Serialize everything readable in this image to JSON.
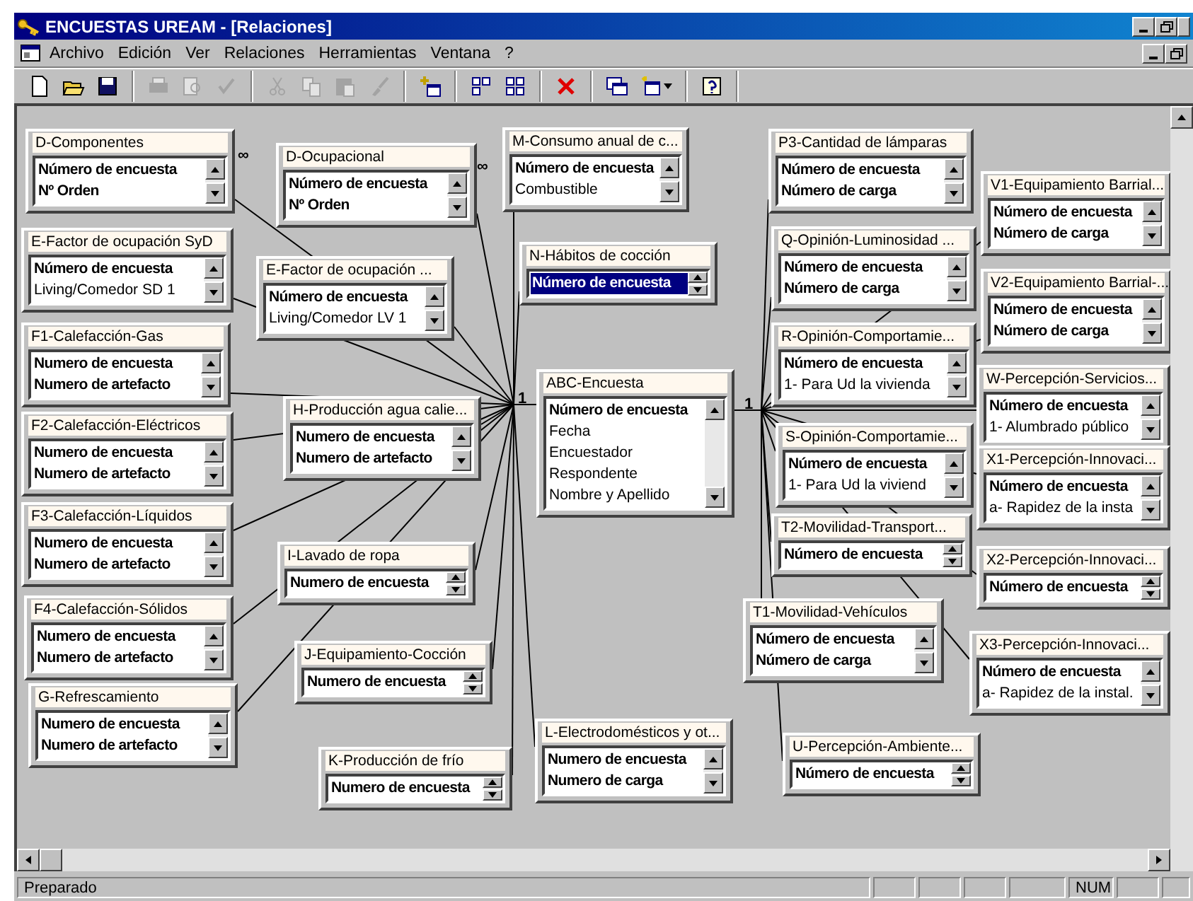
{
  "window": {
    "title": "ENCUESTAS UREAM - [Relaciones]"
  },
  "menu": [
    "Archivo",
    "Edición",
    "Ver",
    "Relaciones",
    "Herramientas",
    "Ventana",
    "?"
  ],
  "toolbar": [
    [
      {
        "disabled": false
      },
      {
        "disabled": false
      },
      {
        "disabled": false
      }
    ],
    [
      {
        "disabled": true
      },
      {
        "disabled": true
      },
      {
        "disabled": true
      }
    ],
    [
      {
        "disabled": true
      },
      {
        "disabled": true
      },
      {
        "disabled": true
      },
      {
        "disabled": true
      }
    ],
    [
      {
        "disabled": false
      }
    ],
    [
      {
        "disabled": false
      },
      {
        "disabled": false
      }
    ],
    [
      {
        "disabled": false
      }
    ],
    [
      {
        "disabled": false
      },
      {
        "disabled": false
      }
    ],
    [
      {
        "disabled": false
      }
    ]
  ],
  "tables": [
    {
      "title": "D-Componentes",
      "fields": [
        {
          "name": "Número de encuesta",
          "key": true,
          "selected": false
        },
        {
          "name": "Nº Orden",
          "key": true,
          "selected": false
        }
      ]
    },
    {
      "title": "M-Consumo anual de c...",
      "fields": [
        {
          "name": "Número de encuesta",
          "key": true,
          "selected": false
        },
        {
          "name": "Combustible",
          "key": false,
          "selected": false
        }
      ]
    },
    {
      "title": "P3-Cantidad de lámparas",
      "fields": [
        {
          "name": "Número de encuesta",
          "key": true,
          "selected": false
        },
        {
          "name": "Número de carga",
          "key": true,
          "selected": false
        }
      ]
    },
    {
      "title": "D-Ocupacional",
      "fields": [
        {
          "name": "Número de encuesta",
          "key": true,
          "selected": false
        },
        {
          "name": "Nº Orden",
          "key": true,
          "selected": false
        }
      ]
    },
    {
      "title": "V1-Equipamiento Barrial...",
      "fields": [
        {
          "name": "Número de encuesta",
          "key": true,
          "selected": false
        },
        {
          "name": "Número de carga",
          "key": true,
          "selected": false
        }
      ]
    },
    {
      "title": "E-Factor de ocupación SyD",
      "fields": [
        {
          "name": "Número de encuesta",
          "key": true,
          "selected": false
        },
        {
          "name": "Living/Comedor SD 1",
          "key": false,
          "selected": false
        }
      ]
    },
    {
      "title": "Q-Opinión-Luminosidad ...",
      "fields": [
        {
          "name": "Número de encuesta",
          "key": true,
          "selected": false
        },
        {
          "name": "Número de carga",
          "key": true,
          "selected": false
        }
      ]
    },
    {
      "title": "E-Factor de ocupación ...",
      "fields": [
        {
          "name": "Número de encuesta",
          "key": true,
          "selected": false
        },
        {
          "name": "Living/Comedor LV 1",
          "key": false,
          "selected": false
        }
      ]
    },
    {
      "title": "N-Hábitos de cocción",
      "fields": [
        {
          "name": "Número de encuesta",
          "key": true,
          "selected": true
        }
      ]
    },
    {
      "title": "V2-Equipamiento Barrial-...",
      "fields": [
        {
          "name": "Número de encuesta",
          "key": true,
          "selected": false
        },
        {
          "name": "Número de carga",
          "key": true,
          "selected": false
        }
      ]
    },
    {
      "title": "F1-Calefacción-Gas",
      "fields": [
        {
          "name": "Numero de encuesta",
          "key": true,
          "selected": false
        },
        {
          "name": "Numero de artefacto",
          "key": true,
          "selected": false
        }
      ]
    },
    {
      "title": "R-Opinión-Comportamie...",
      "fields": [
        {
          "name": "Número de encuesta",
          "key": true,
          "selected": false
        },
        {
          "name": "1- Para Ud la vivienda",
          "key": false,
          "selected": false
        }
      ]
    },
    {
      "title": "ABC-Encuesta",
      "fields": [
        {
          "name": "Número de encuesta",
          "key": true,
          "selected": false
        },
        {
          "name": "Fecha",
          "key": false,
          "selected": false
        },
        {
          "name": "Encuestador",
          "key": false,
          "selected": false
        },
        {
          "name": "Respondente",
          "key": false,
          "selected": false
        },
        {
          "name": "Nombre y Apellido",
          "key": false,
          "selected": false
        }
      ]
    },
    {
      "title": "W-Percepción-Servicios...",
      "fields": [
        {
          "name": "Número de encuesta",
          "key": true,
          "selected": false
        },
        {
          "name": "1- Alumbrado público",
          "key": false,
          "selected": false
        }
      ]
    },
    {
      "title": "H-Producción agua calie...",
      "fields": [
        {
          "name": "Numero de encuesta",
          "key": true,
          "selected": false
        },
        {
          "name": "Numero de artefacto",
          "key": true,
          "selected": false
        }
      ]
    },
    {
      "title": "F2-Calefacción-Eléctricos",
      "fields": [
        {
          "name": "Numero de encuesta",
          "key": true,
          "selected": false
        },
        {
          "name": "Numero de artefacto",
          "key": true,
          "selected": false
        }
      ]
    },
    {
      "title": "S-Opinión-Comportamie...",
      "fields": [
        {
          "name": "Número de encuesta",
          "key": true,
          "selected": false
        },
        {
          "name": "1- Para Ud la viviend",
          "key": false,
          "selected": false
        }
      ]
    },
    {
      "title": "X1-Percepción-Innovaci...",
      "fields": [
        {
          "name": "Número de encuesta",
          "key": true,
          "selected": false
        },
        {
          "name": "a- Rapidez de la insta",
          "key": false,
          "selected": false
        }
      ]
    },
    {
      "title": "F3-Calefacción-Líquidos",
      "fields": [
        {
          "name": "Numero de encuesta",
          "key": true,
          "selected": false
        },
        {
          "name": "Numero de artefacto",
          "key": true,
          "selected": false
        }
      ]
    },
    {
      "title": "T2-Movilidad-Transport...",
      "fields": [
        {
          "name": "Número de encuesta",
          "key": true,
          "selected": false
        }
      ]
    },
    {
      "title": "I-Lavado de ropa",
      "fields": [
        {
          "name": "Numero de encuesta",
          "key": true,
          "selected": false
        }
      ]
    },
    {
      "title": "X2-Percepción-Innovaci...",
      "fields": [
        {
          "name": "Número de encuesta",
          "key": true,
          "selected": false
        }
      ]
    },
    {
      "title": "F4-Calefacción-Sólidos",
      "fields": [
        {
          "name": "Numero de encuesta",
          "key": true,
          "selected": false
        },
        {
          "name": "Numero de artefacto",
          "key": true,
          "selected": false
        }
      ]
    },
    {
      "title": "T1-Movilidad-Vehículos",
      "fields": [
        {
          "name": "Número de encuesta",
          "key": true,
          "selected": false
        },
        {
          "name": "Número de carga",
          "key": true,
          "selected": false
        }
      ]
    },
    {
      "title": "J-Equipamiento-Cocción",
      "fields": [
        {
          "name": "Numero de encuesta",
          "key": true,
          "selected": false
        }
      ]
    },
    {
      "title": "X3-Percepción-Innovaci...",
      "fields": [
        {
          "name": "Número de encuesta",
          "key": true,
          "selected": false
        },
        {
          "name": "a- Rapidez de la instal.",
          "key": false,
          "selected": false
        }
      ]
    },
    {
      "title": "G-Refrescamiento",
      "fields": [
        {
          "name": "Numero de encuesta",
          "key": true,
          "selected": false
        },
        {
          "name": "Numero de artefacto",
          "key": true,
          "selected": false
        }
      ]
    },
    {
      "title": "K-Producción de frío",
      "fields": [
        {
          "name": "Numero de encuesta",
          "key": true,
          "selected": false
        }
      ]
    },
    {
      "title": "L-Electrodomésticos y ot...",
      "fields": [
        {
          "name": "Numero de encuesta",
          "key": true,
          "selected": false
        },
        {
          "name": "Numero de carga",
          "key": true,
          "selected": false
        }
      ]
    },
    {
      "title": "U-Percepción-Ambiente...",
      "fields": [
        {
          "name": "Número de encuesta",
          "key": true,
          "selected": false
        }
      ]
    }
  ],
  "cardinality_marks": [
    "∞",
    "∞",
    "1",
    "1"
  ],
  "status_bar": {
    "message": "Preparado",
    "indicators": [
      "NUM"
    ]
  }
}
